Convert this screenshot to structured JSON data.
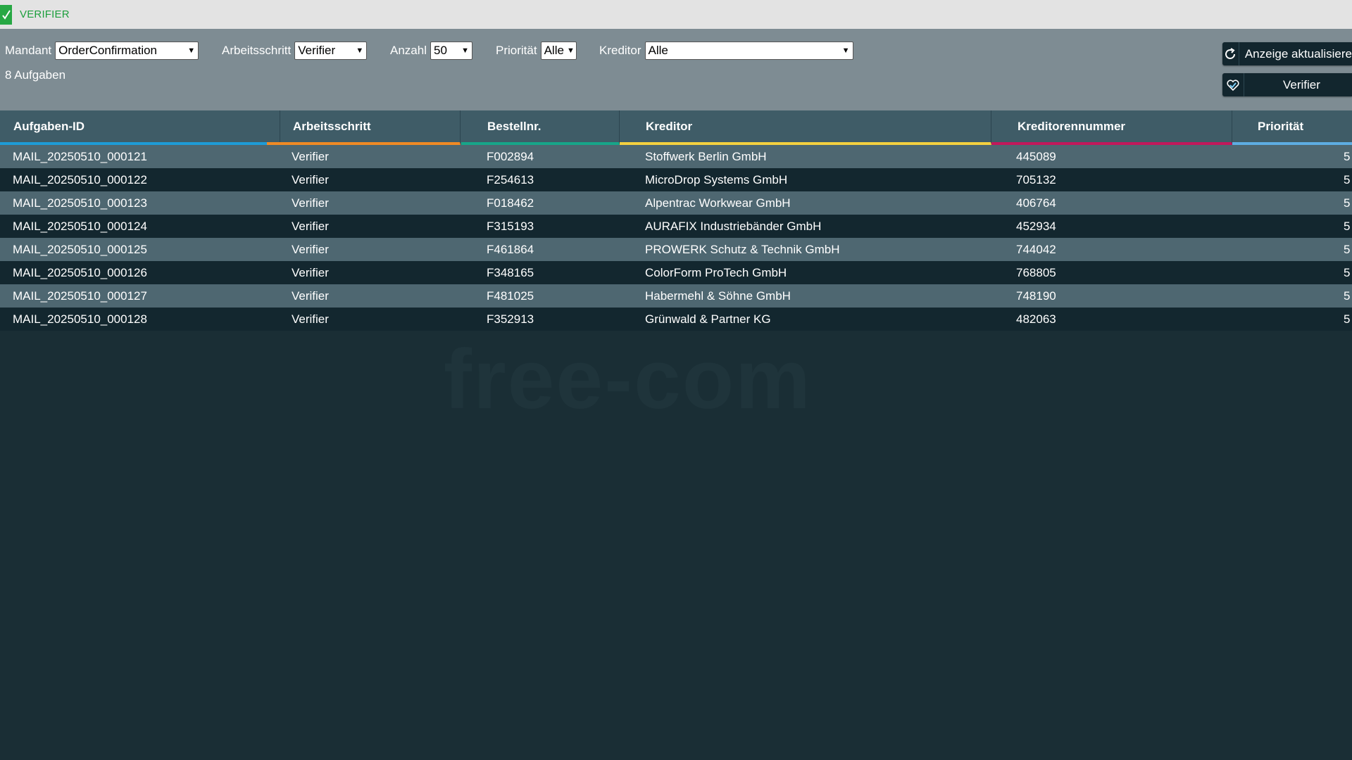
{
  "app": {
    "title": "VERIFIER",
    "check_icon": "check-icon"
  },
  "filters": {
    "mandant": {
      "label": "Mandant",
      "value": "OrderConfirmation"
    },
    "arbeitsschritt": {
      "label": "Arbeitsschritt",
      "value": "Verifier"
    },
    "anzahl": {
      "label": "Anzahl",
      "value": "50"
    },
    "prioritaet": {
      "label": "Priorität",
      "value": "Alle"
    },
    "kreditor": {
      "label": "Kreditor",
      "value": "Alle"
    }
  },
  "count_text": "8 Aufgaben",
  "buttons": {
    "refresh": {
      "label": "Anzeige aktualisiere",
      "icon": "refresh-icon"
    },
    "verifier": {
      "label": "Verifier",
      "icon": "verifier-icon"
    }
  },
  "columns": [
    {
      "label": "Aufgaben-ID",
      "color": "#1e9bd7"
    },
    {
      "label": "Arbeitsschritt",
      "color": "#f08a24"
    },
    {
      "label": "Bestellnr.",
      "color": "#17a589"
    },
    {
      "label": "Kreditor",
      "color": "#f4d03f"
    },
    {
      "label": "Kreditorennummer",
      "color": "#c2185b"
    },
    {
      "label": "Priorität",
      "color": "#5dade2"
    }
  ],
  "rows": [
    {
      "id": "MAIL_20250510_000121",
      "step": "Verifier",
      "order": "F002894",
      "creditor": "Stoffwerk Berlin GmbH",
      "creditor_no": "445089",
      "priority": "5"
    },
    {
      "id": "MAIL_20250510_000122",
      "step": "Verifier",
      "order": "F254613",
      "creditor": "MicroDrop Systems GmbH",
      "creditor_no": "705132",
      "priority": "5"
    },
    {
      "id": "MAIL_20250510_000123",
      "step": "Verifier",
      "order": "F018462",
      "creditor": "Alpentrac Workwear GmbH",
      "creditor_no": "406764",
      "priority": "5"
    },
    {
      "id": "MAIL_20250510_000124",
      "step": "Verifier",
      "order": "F315193",
      "creditor": "AURAFIX Industriebänder GmbH",
      "creditor_no": "452934",
      "priority": "5"
    },
    {
      "id": "MAIL_20250510_000125",
      "step": "Verifier",
      "order": "F461864",
      "creditor": "PROWERK Schutz & Technik GmbH",
      "creditor_no": "744042",
      "priority": "5"
    },
    {
      "id": "MAIL_20250510_000126",
      "step": "Verifier",
      "order": "F348165",
      "creditor": "ColorForm ProTech GmbH",
      "creditor_no": "768805",
      "priority": "5"
    },
    {
      "id": "MAIL_20250510_000127",
      "step": "Verifier",
      "order": "F481025",
      "creditor": "Habermehl & Söhne GmbH",
      "creditor_no": "748190",
      "priority": "5"
    },
    {
      "id": "MAIL_20250510_000128",
      "step": "Verifier",
      "order": "F352913",
      "creditor": "Grünwald & Partner KG",
      "creditor_no": "482063",
      "priority": "5"
    }
  ],
  "watermark": "free-com"
}
